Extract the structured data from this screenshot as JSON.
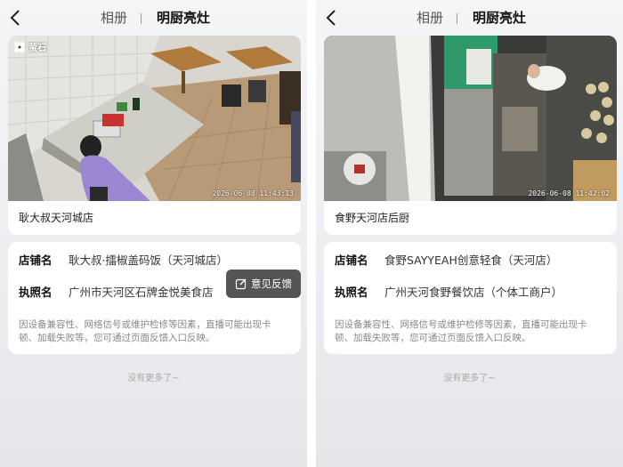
{
  "header": {
    "tab_album": "相册",
    "tab_kitchen": "明厨亮灶"
  },
  "labels": {
    "shop_name": "店铺名",
    "license_name": "执照名"
  },
  "left": {
    "watermark": "萤石",
    "timestamp": "2026-06-08 11:43:13",
    "camera_title": "耿大叔天河城店",
    "shop_name": "耿大叔·擂椒盖码饭（天河城店）",
    "license_name": "广州市天河区石牌金悦美食店",
    "feedback": "意见反馈",
    "notice": "因设备兼容性、网络信号或维护检修等因素，直播可能出现卡顿、加载失败等，您可通过页面反馈入口反映。",
    "no_more": "没有更多了~"
  },
  "right": {
    "timestamp": "2026-06-08 11:42:02",
    "camera_title": "食野天河店后厨",
    "shop_name": "食野SAYYEAH创意轻食（天河店）",
    "license_name": "广州天河食野餐饮店（个体工商户）",
    "notice": "因设备兼容性、网络信号或维护检修等因素，直播可能出现卡顿、加载失败等，您可通过页面反馈入口反映。",
    "no_more": "没有更多了~"
  }
}
